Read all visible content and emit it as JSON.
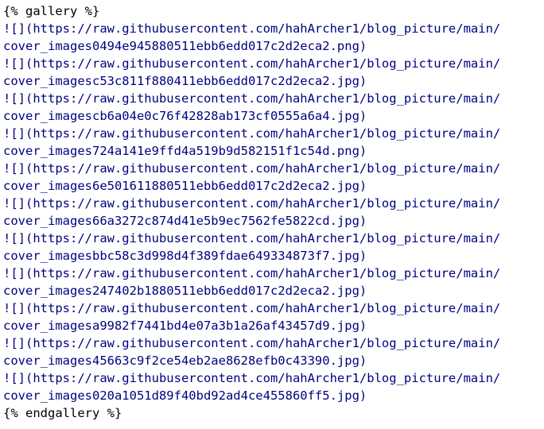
{
  "document": {
    "open_tag": "{% gallery %}",
    "close_tag": "{% endgallery %}",
    "colors": {
      "tag": "#000000",
      "markdown": "#000080",
      "background": "#ffffff"
    },
    "entries": [
      {
        "line1": "![](https://raw.githubusercontent.com/hahArcher1/blog_picture/main/",
        "line2": "cover_images0494e945880511ebb6edd017c2d2eca2.png)"
      },
      {
        "line1": "![](https://raw.githubusercontent.com/hahArcher1/blog_picture/main/",
        "line2": "cover_imagesc53c811f880411ebb6edd017c2d2eca2.jpg)"
      },
      {
        "line1": "![](https://raw.githubusercontent.com/hahArcher1/blog_picture/main/",
        "line2": "cover_imagescb6a04e0c76f42828ab173cf0555a6a4.jpg)"
      },
      {
        "line1": "![](https://raw.githubusercontent.com/hahArcher1/blog_picture/main/",
        "line2": "cover_images724a141e9ffd4a519b9d582151f1c54d.png)"
      },
      {
        "line1": "![](https://raw.githubusercontent.com/hahArcher1/blog_picture/main/",
        "line2": "cover_images6e501611880511ebb6edd017c2d2eca2.jpg)"
      },
      {
        "line1": "![](https://raw.githubusercontent.com/hahArcher1/blog_picture/main/",
        "line2": "cover_images66a3272c874d41e5b9ec7562fe5822cd.jpg)"
      },
      {
        "line1": "![](https://raw.githubusercontent.com/hahArcher1/blog_picture/main/",
        "line2": "cover_imagesbbc58c3d998d4f389fdae649334873f7.jpg)"
      },
      {
        "line1": "![](https://raw.githubusercontent.com/hahArcher1/blog_picture/main/",
        "line2": "cover_images247402b1880511ebb6edd017c2d2eca2.jpg)"
      },
      {
        "line1": "![](https://raw.githubusercontent.com/hahArcher1/blog_picture/main/",
        "line2": "cover_imagesa9982f7441bd4e07a3b1a26af43457d9.jpg)"
      },
      {
        "line1": "![](https://raw.githubusercontent.com/hahArcher1/blog_picture/main/",
        "line2": "cover_images45663c9f2ce54eb2ae8628efb0c43390.jpg)"
      },
      {
        "line1": "![](https://raw.githubusercontent.com/hahArcher1/blog_picture/main/",
        "line2": "cover_images020a1051d89f40bd92ad4ce455860ff5.jpg)"
      }
    ]
  }
}
